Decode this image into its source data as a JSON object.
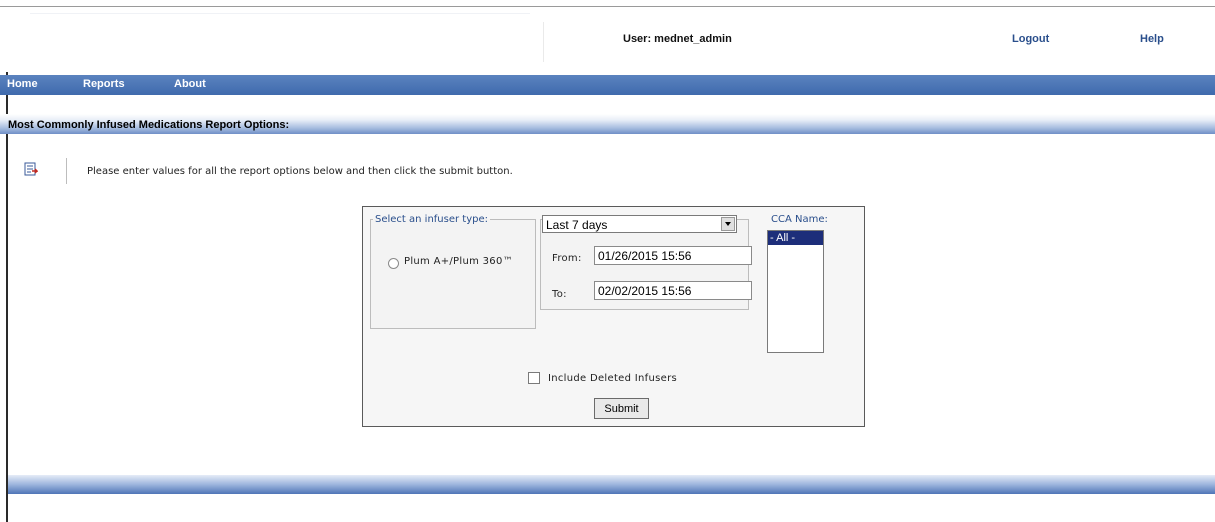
{
  "header": {
    "user_label": "User: mednet_admin",
    "logout_label": "Logout",
    "help_label": "Help"
  },
  "nav": {
    "items": [
      "Home",
      "Reports",
      "About"
    ]
  },
  "section": {
    "title": "Most Commonly Infused Medications Report Options:"
  },
  "instructions": "Please enter values for all the report options below and then click the submit button.",
  "form": {
    "infuser_legend": "Select an infuser type:",
    "infuser_option": "Plum A+/Plum 360™",
    "date_range_selected": "Last 7 days",
    "from_label": "From:",
    "from_value": "01/26/2015 15:56",
    "to_label": "To:",
    "to_value": "02/02/2015 15:56",
    "cca_legend": "CCA Name:",
    "cca_options": [
      "- All -"
    ],
    "include_deleted_label": "Include Deleted Infusers",
    "submit_label": "Submit"
  },
  "colors": {
    "nav_bg": "#4a73b3",
    "link": "#2a4f8c",
    "legend": "#2a4f8c",
    "list_selected": "#1d2e7a"
  }
}
